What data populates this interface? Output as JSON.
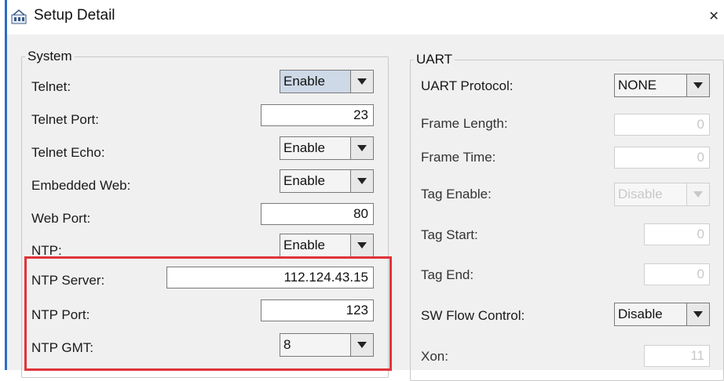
{
  "window": {
    "title": "Setup Detail",
    "close_glyph": "×",
    "app_icon": "setup-app-icon"
  },
  "system": {
    "legend": "System",
    "telnet": {
      "label": "Telnet:",
      "value": "Enable"
    },
    "telnet_port": {
      "label": "Telnet Port:",
      "value": "23"
    },
    "telnet_echo": {
      "label": "Telnet Echo:",
      "value": "Enable"
    },
    "embedded_web": {
      "label": "Embedded Web:",
      "value": "Enable"
    },
    "web_port": {
      "label": "Web Port:",
      "value": "80"
    },
    "ntp": {
      "label": "NTP:",
      "value": "Enable"
    },
    "ntp_server": {
      "label": "NTP Server:",
      "value": "112.124.43.15"
    },
    "ntp_port": {
      "label": "NTP Port:",
      "value": "123"
    },
    "ntp_gmt": {
      "label": "NTP GMT:",
      "value": "8"
    }
  },
  "uart": {
    "legend": "UART",
    "protocol": {
      "label": "UART Protocol:",
      "value": "NONE"
    },
    "frame_length": {
      "label": "Frame Length:",
      "value": "0"
    },
    "frame_time": {
      "label": "Frame Time:",
      "value": "0"
    },
    "tag_enable": {
      "label": "Tag Enable:",
      "value": "Disable"
    },
    "tag_start": {
      "label": "Tag Start:",
      "value": "0"
    },
    "tag_end": {
      "label": "Tag End:",
      "value": "0"
    },
    "sw_flow_control": {
      "label": "SW Flow Control:",
      "value": "Disable"
    },
    "xon": {
      "label": "Xon:",
      "value": "11"
    }
  },
  "colors": {
    "highlight_box": "#e0333a",
    "selected_combo": "#cdd9e6",
    "window_edge": "#2b6cc4"
  }
}
